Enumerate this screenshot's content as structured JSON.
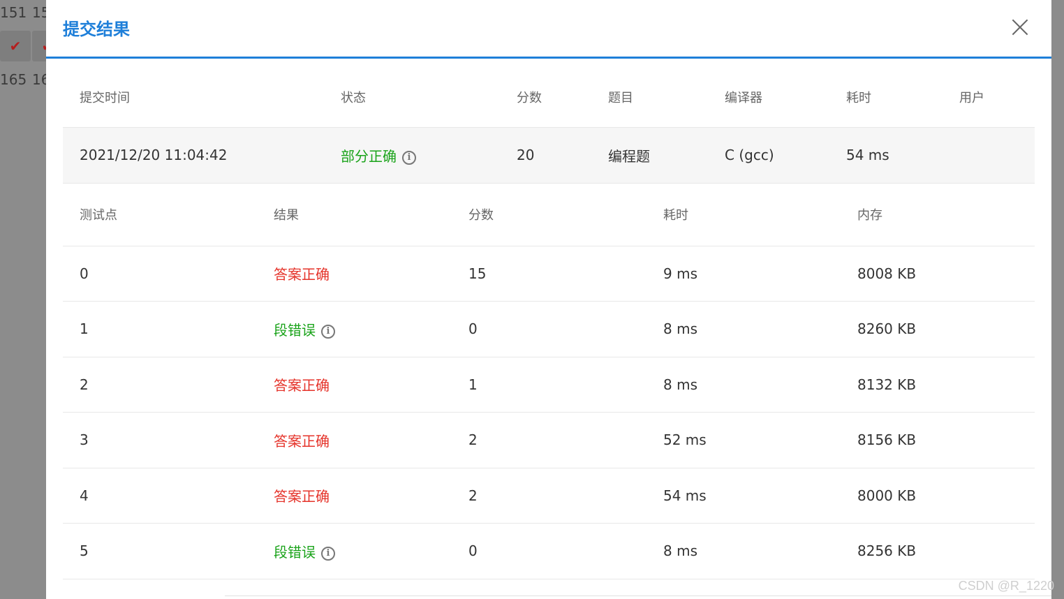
{
  "background": {
    "cells": [
      {
        "text": "151",
        "row": 0,
        "col": 0
      },
      {
        "text": "15",
        "row": 0,
        "col": 1
      },
      {
        "text": "✔",
        "row": 1,
        "col": 0,
        "icon": "check-icon"
      },
      {
        "text": "✔",
        "row": 1,
        "col": 1,
        "icon": "check-icon"
      },
      {
        "text": "165",
        "row": 2,
        "col": 0
      },
      {
        "text": "16",
        "row": 2,
        "col": 1
      }
    ]
  },
  "modal": {
    "title": "提交结果",
    "close_icon": "close-icon"
  },
  "summary": {
    "headers": [
      "提交时间",
      "状态",
      "分数",
      "题目",
      "编译器",
      "耗时",
      "用户"
    ],
    "row": {
      "time": "2021/12/20 11:04:42",
      "status": "部分正确",
      "score": "20",
      "problem": "编程题",
      "compiler": "C (gcc)",
      "elapsed": "54 ms",
      "user": ""
    }
  },
  "cases": {
    "headers": [
      "测试点",
      "结果",
      "分数",
      "耗时",
      "内存"
    ],
    "rows": [
      {
        "id": "0",
        "result": "答案正确",
        "status": "ok",
        "score": "15",
        "time": "9 ms",
        "memory": "8008 KB"
      },
      {
        "id": "1",
        "result": "段错误",
        "status": "err",
        "score": "0",
        "time": "8 ms",
        "memory": "8260 KB"
      },
      {
        "id": "2",
        "result": "答案正确",
        "status": "ok",
        "score": "1",
        "time": "8 ms",
        "memory": "8132 KB"
      },
      {
        "id": "3",
        "result": "答案正确",
        "status": "ok",
        "score": "2",
        "time": "52 ms",
        "memory": "8156 KB"
      },
      {
        "id": "4",
        "result": "答案正确",
        "status": "ok",
        "score": "2",
        "time": "54 ms",
        "memory": "8000 KB"
      },
      {
        "id": "5",
        "result": "段错误",
        "status": "err",
        "score": "0",
        "time": "8 ms",
        "memory": "8256 KB"
      }
    ]
  },
  "colors": {
    "accent": "#1e7fd9",
    "correct": "#e5332a",
    "partial": "#1aa31a",
    "error": "#1aa31a"
  },
  "watermark": "CSDN @R_1220"
}
